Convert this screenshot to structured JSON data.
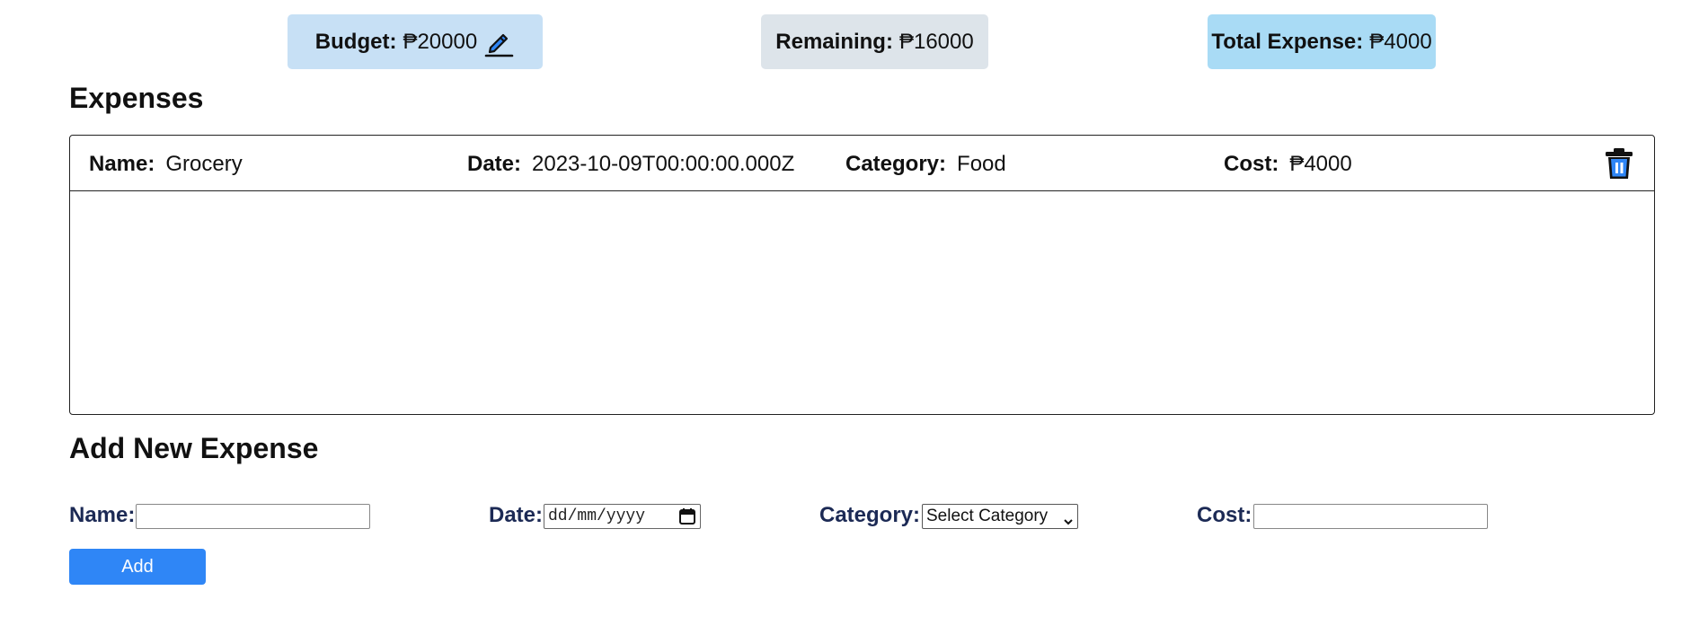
{
  "summary": {
    "budget_label": "Budget:",
    "budget_value": "₱20000",
    "remaining_label": "Remaining:",
    "remaining_value": "₱16000",
    "total_label": "Total Expense:",
    "total_value": "₱4000",
    "edit_icon": "pencil-icon"
  },
  "expenses": {
    "heading": "Expenses",
    "items": [
      {
        "name_label": "Name:",
        "name": "Grocery",
        "date_label": "Date:",
        "date": "2023-10-09T00:00:00.000Z",
        "category_label": "Category:",
        "category": "Food",
        "cost_label": "Cost:",
        "cost": "₱4000",
        "delete_icon": "trash-icon"
      }
    ]
  },
  "add_form": {
    "heading": "Add New Expense",
    "name_label": "Name:",
    "name_value": "",
    "date_label": "Date:",
    "date_placeholder": "dd/mm/yyyy",
    "category_label": "Category:",
    "category_selected": "Select Category",
    "cost_label": "Cost:",
    "cost_value": "",
    "add_label": "Add"
  },
  "colors": {
    "budget_bg": "#c7e0f5",
    "remaining_bg": "#dde4ea",
    "total_bg": "#a9dbf5",
    "accent": "#2f86f6",
    "form_label": "#1c2a55"
  }
}
